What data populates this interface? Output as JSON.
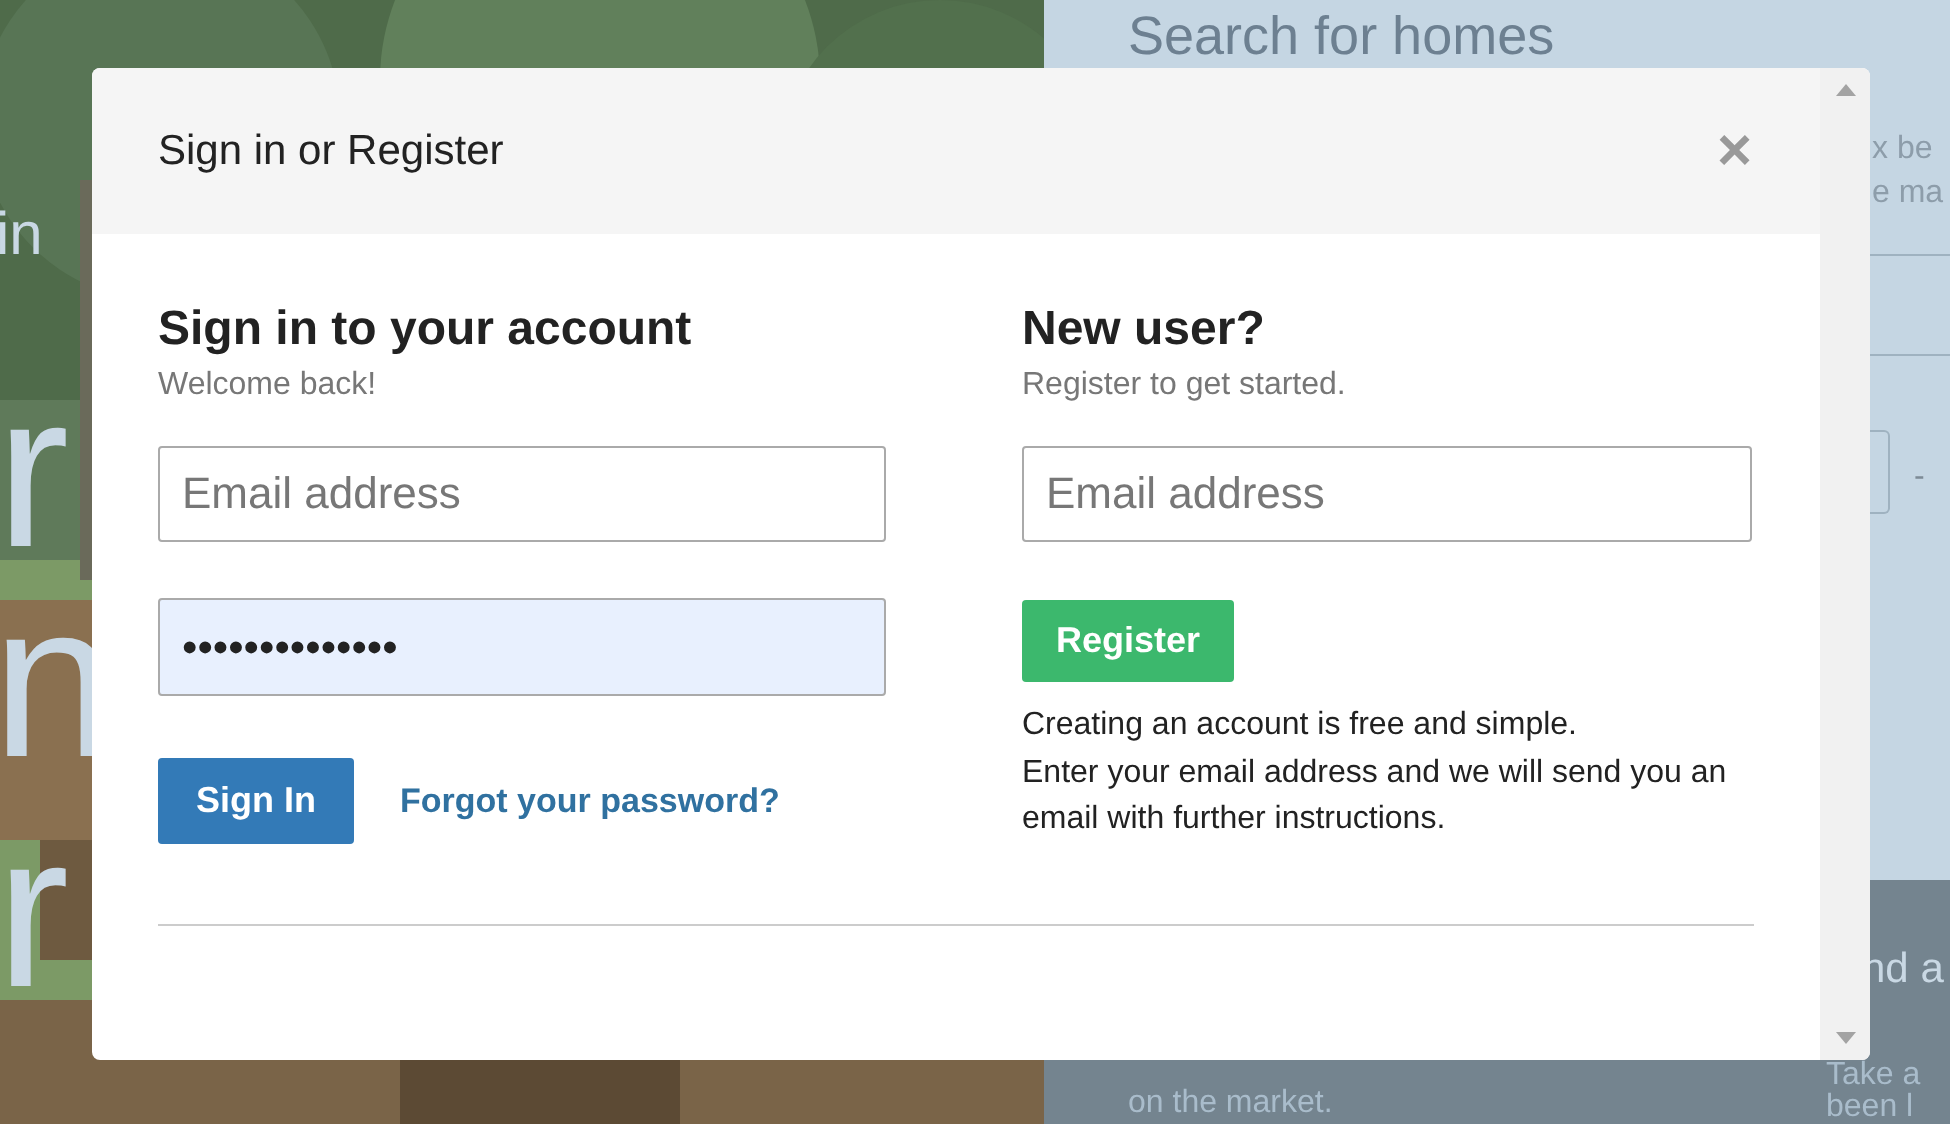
{
  "background": {
    "hero_lines": [
      "in",
      "r",
      "n",
      "r"
    ],
    "search_panel": {
      "title": "Search for homes",
      "text_lines": [
        "x be",
        "e ma"
      ],
      "range_separator": "-"
    },
    "footer_panels": [
      {
        "lines": [
          "on the market."
        ]
      },
      {
        "title": "nd a",
        "lines": [
          "Take a",
          "been l"
        ]
      }
    ]
  },
  "modal": {
    "title": "Sign in or Register",
    "close": "×",
    "sign_in": {
      "heading": "Sign in to your account",
      "subtitle": "Welcome back!",
      "email_placeholder": "Email address",
      "password_value": "••••••••••••••",
      "button": "Sign In",
      "forgot_link": "Forgot your password?"
    },
    "register": {
      "heading": "New user?",
      "subtitle": "Register to get started.",
      "email_placeholder": "Email address",
      "button": "Register",
      "info_lines": [
        "Creating an account is free and simple.",
        "Enter your email address and we will send you an email with further instructions."
      ]
    }
  }
}
